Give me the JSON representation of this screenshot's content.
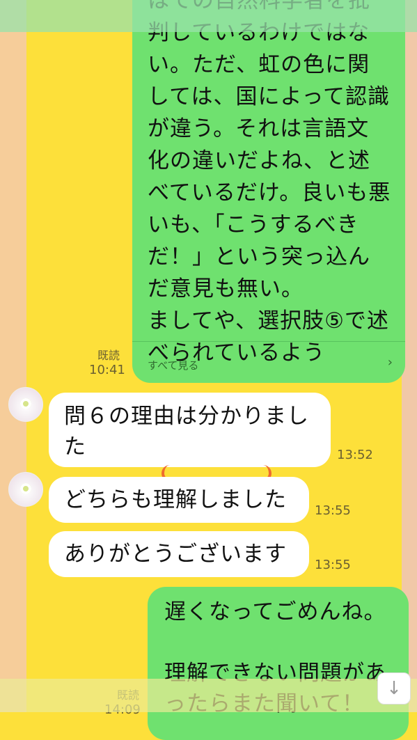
{
  "messages": {
    "long_message": {
      "text": "はての自然科学者を批判しているわけではない。ただ、虹の色に関しては、国によって認識が違う。それは言語文化の違いだよね、と述べているだけ。良いも悪いも、「こうするべきだ！」という突っ込んだ意見も無い。\nましてや、選択肢⑤で述べられているよう",
      "see_all": "すべて見る",
      "read": "既読",
      "time": "10:41"
    },
    "incoming": [
      {
        "text": "問６の理由は分かりました",
        "time": "13:52"
      },
      {
        "text": "どちらも理解しました",
        "time": "13:55"
      },
      {
        "text": "ありがとうございます",
        "time": "13:55"
      }
    ],
    "last_outgoing": {
      "text": "遅くなってごめんね。\n\n理解できない問題があったらまた聞いて！",
      "read": "既読",
      "time": "14:09"
    }
  },
  "icons": {
    "chevron": "chevron-right-icon",
    "scroll": "arrow-down-icon"
  },
  "colors": {
    "background": "#fde03a",
    "outgoing_bubble": "#6fe16f",
    "incoming_bubble": "#ffffff"
  }
}
